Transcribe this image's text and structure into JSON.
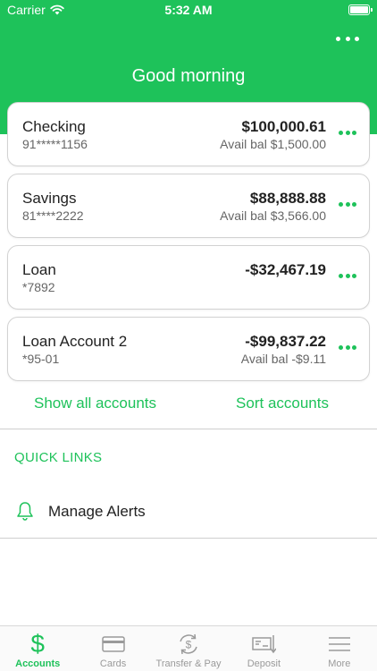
{
  "status_bar": {
    "carrier": "Carrier",
    "time": "5:32 AM"
  },
  "header": {
    "greeting": "Good morning",
    "more_icon": "ellipsis-icon"
  },
  "accounts": [
    {
      "name": "Checking",
      "number": "91*****1156",
      "balance": "$100,000.61",
      "avail": "Avail bal $1,500.00"
    },
    {
      "name": "Savings",
      "number": "81****2222",
      "balance": "$88,888.88",
      "avail": "Avail bal $3,566.00"
    },
    {
      "name": "Loan",
      "number": "*7892",
      "balance": "-$32,467.19",
      "avail": ""
    },
    {
      "name": "Loan Account 2",
      "number": "*95-01",
      "balance": "-$99,837.22",
      "avail": "Avail bal -$9.11"
    }
  ],
  "links": {
    "show_all": "Show all accounts",
    "sort": "Sort accounts"
  },
  "quick_links": {
    "title": "QUICK LINKS",
    "items": [
      {
        "label": "Manage Alerts",
        "icon": "bell-icon"
      }
    ]
  },
  "tabbar": {
    "items": [
      {
        "label": "Accounts",
        "icon": "dollar-icon",
        "active": true
      },
      {
        "label": "Cards",
        "icon": "card-icon",
        "active": false
      },
      {
        "label": "Transfer & Pay",
        "icon": "transfer-icon",
        "active": false
      },
      {
        "label": "Deposit",
        "icon": "check-deposit-icon",
        "active": false
      },
      {
        "label": "More",
        "icon": "menu-icon",
        "active": false
      }
    ]
  },
  "colors": {
    "brand": "#1ec25a",
    "text": "#222222",
    "muted": "#666666",
    "tab_inactive": "#9a9a9a"
  }
}
